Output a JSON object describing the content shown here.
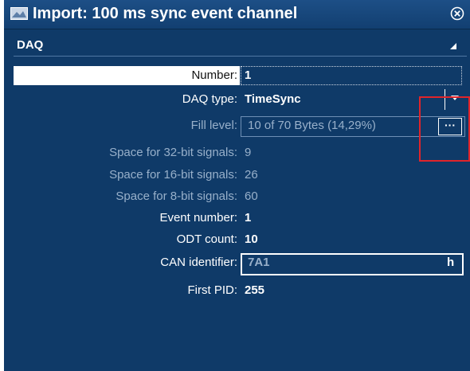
{
  "window": {
    "title": "Import: 100 ms sync event channel",
    "icons": {
      "title": "channel-icon",
      "close": "close-circle-icon"
    }
  },
  "section": {
    "title": "DAQ",
    "toggle_icon": "collapse-triangle-icon"
  },
  "fields": {
    "number": {
      "label": "Number:",
      "value": "1"
    },
    "daq_type": {
      "label": "DAQ type:",
      "value": "TimeSync",
      "icon": "dropdown-arrow-icon"
    },
    "fill_level": {
      "label": "Fill level:",
      "value": "10 of 70 Bytes (14,29%)",
      "button": "···"
    },
    "space_32": {
      "label": "Space for 32-bit signals:",
      "value": "9"
    },
    "space_16": {
      "label": "Space for 16-bit signals:",
      "value": "26"
    },
    "space_8": {
      "label": "Space for 8-bit signals:",
      "value": "60"
    },
    "event_number": {
      "label": "Event number:",
      "value": "1"
    },
    "odt_count": {
      "label": "ODT count:",
      "value": "10"
    },
    "can_identifier": {
      "label": "CAN identifier:",
      "value": "7A1",
      "unit": "h"
    },
    "first_pid": {
      "label": "First PID:",
      "value": "255"
    }
  },
  "colors": {
    "panel_background": "#0f3a68",
    "highlight_box": "#e0242a",
    "dim_text": "#98b0ca"
  }
}
